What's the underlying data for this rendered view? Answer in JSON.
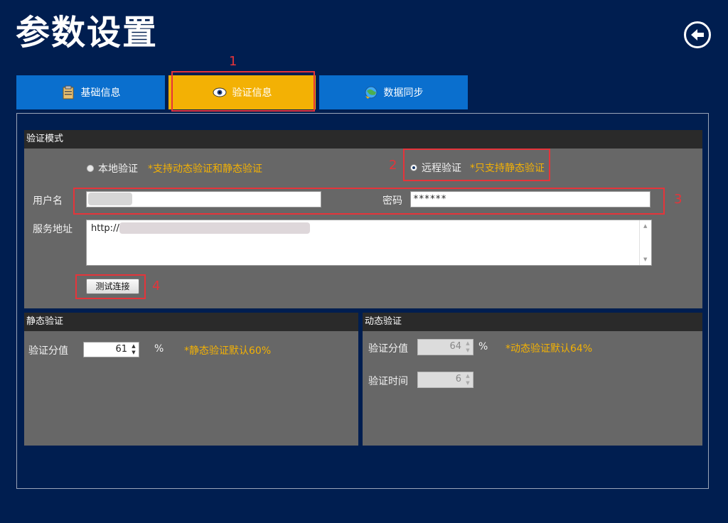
{
  "header": {
    "title": "参数设置",
    "back_icon": "back-arrow-icon"
  },
  "tabs": [
    {
      "label": "基础信息",
      "icon": "clipboard-icon"
    },
    {
      "label": "验证信息",
      "icon": "eye-icon",
      "active": true
    },
    {
      "label": "数据同步",
      "icon": "globe-sync-icon"
    }
  ],
  "annotations": [
    "1",
    "2",
    "3",
    "4"
  ],
  "verify_mode": {
    "title": "验证模式",
    "local": {
      "label": "本地验证",
      "hint": "*支持动态验证和静态验证",
      "selected": false
    },
    "remote": {
      "label": "远程验证",
      "hint": "*只支持静态验证",
      "selected": true
    },
    "username_label": "用户名",
    "username_value": "",
    "password_label": "密码",
    "password_value": "******",
    "service_label": "服务地址",
    "service_value": "http://",
    "test_button": "测试连接"
  },
  "static_verify": {
    "title": "静态验证",
    "score_label": "验证分值",
    "score_value": "61",
    "unit": "%",
    "hint": "*静态验证默认60%"
  },
  "dynamic_verify": {
    "title": "动态验证",
    "score_label": "验证分值",
    "score_value": "64",
    "unit": "%",
    "hint": "*动态验证默认64%",
    "time_label": "验证时间",
    "time_value": "6"
  },
  "colors": {
    "background": "#001e50",
    "tab": "#0a6fce",
    "tab_active": "#f3b104",
    "hint": "#f3b104",
    "annotation": "#e5343a"
  }
}
